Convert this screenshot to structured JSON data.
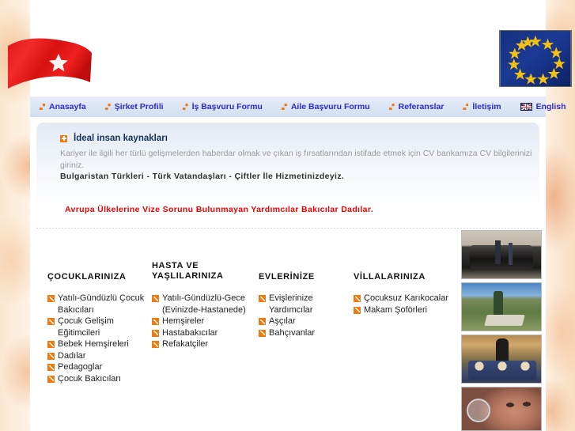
{
  "header": {
    "flag_left": "turkish-flag",
    "flag_right": "european-union-flag"
  },
  "nav": {
    "items": [
      {
        "label": "Anasayfa",
        "icon": "orange-arrow-icon"
      },
      {
        "label": "Şirket Profili",
        "icon": "orange-arrow-icon"
      },
      {
        "label": "İş Başvuru Formu",
        "icon": "orange-arrow-icon"
      },
      {
        "label": "Aile Başvuru Formu",
        "icon": "orange-arrow-icon"
      },
      {
        "label": "Referanslar",
        "icon": "orange-arrow-icon"
      },
      {
        "label": "İletişim",
        "icon": "orange-arrow-icon"
      },
      {
        "label": "English",
        "icon": "uk-flag-icon"
      }
    ]
  },
  "intro": {
    "heading": "İdeal insan kaynakları",
    "body": "Kariyer ile ilgili her türlü gelişmelerden haberdar olmak ve çıkan iş fırsatlarından istifade etmek için CV bankamıza CV bilgilerinizi giriniz.",
    "bold_line": "Bulgaristan Türkleri - Türk Vatandaşları - Çiftler İle Hizmetinizdeyiz.",
    "red_line": "Avrupa Ülkelerine Vize Sorunu Bulunmayan Yardımcılar Bakıcılar Dadılar."
  },
  "columns": [
    {
      "title": "ÇOCUKLARINIZA",
      "items": [
        "Yatılı-Gündüzlü Çocuk Bakıcıları",
        "Çocuk Gelişim Eğitimcileri",
        "Bebek Hemşireleri",
        "Dadılar",
        "Pedagoglar",
        "Çocuk Bakıcıları"
      ]
    },
    {
      "title": "HASTA VE YAŞLILARINIZA",
      "items": [
        "Yatılı-Gündüzlü-Gece (Evinizde-Hastanede)",
        "Hemşireler",
        "Hastabakıcılar",
        "Refakatçiler"
      ]
    },
    {
      "title": "EVLERİNİZE",
      "items": [
        "Evişlerinize Yardımcılar",
        "Aşçılar",
        "Bahçıvanlar"
      ]
    },
    {
      "title": "VİLLALARINIZA",
      "items": [
        "Çocuksuz Karıkocalar",
        "Makam Şoförleri"
      ]
    }
  ],
  "photos": [
    {
      "name": "chauffeur-limousine-photo"
    },
    {
      "name": "gardener-photo"
    },
    {
      "name": "nanny-with-triplets-photo"
    },
    {
      "name": "baby-photo"
    }
  ],
  "colors": {
    "accent_orange": "#f07a10",
    "nav_link_blue": "#2a2ad0",
    "alert_red": "#ef0000",
    "nav_bar_bg": "#dbe5f4"
  }
}
